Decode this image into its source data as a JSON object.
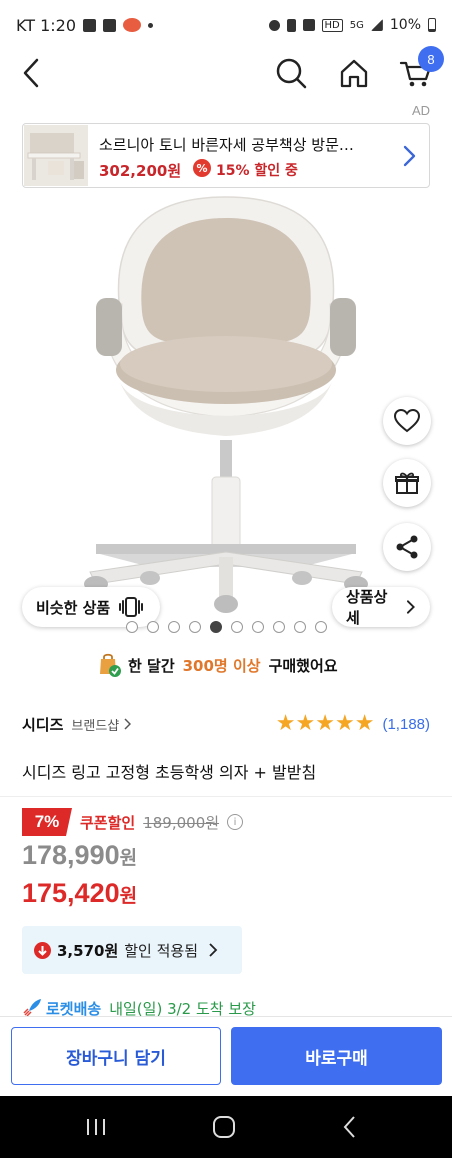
{
  "status_bar": {
    "carrier_time": "KT 1:20",
    "battery": "10%",
    "network": "5G"
  },
  "nav": {
    "cart_count": "8",
    "icons": [
      "back-icon",
      "search-icon",
      "home-icon",
      "cart-icon"
    ]
  },
  "ad": {
    "label": "AD",
    "title": "소르니아 토니 바른자세 공부책상 방문…",
    "price": "302,200원",
    "discount_icon": "%",
    "discount": "15% 할인 중"
  },
  "image": {
    "similar_label": "비슷한 상품",
    "detail_label": "상품상세",
    "dot_count": 10,
    "active_dot": 4
  },
  "purchase": {
    "prefix": "한 달간",
    "count": "300명 이상",
    "suffix": "구매했어요"
  },
  "product": {
    "brand": "시디즈",
    "brand_shop": "브랜드샵",
    "rating_stars": 5,
    "review_count": "(1,188)",
    "title": "시디즈 링고 고정형 초등학생 의자 + 발받침"
  },
  "price": {
    "discount_rate": "7%",
    "coupon_label": "쿠폰할인",
    "original": "189,000원",
    "info_icon": "i",
    "sale_number": "178,990",
    "sale_unit": "원",
    "coupon_number": "175,420",
    "coupon_unit": "원",
    "savings_amount": "3,570원",
    "savings_label": "할인 적용됨"
  },
  "delivery": {
    "rocket_label": "로켓배송",
    "info": "내일(일) 3/2 도착 보장"
  },
  "actions": {
    "cart_label": "장바구니 담기",
    "buy_label": "바로구매"
  },
  "colors": {
    "accent_blue": "#3f6ef0",
    "sale_red": "#dd2a28",
    "rating_star": "#f5a623",
    "purchase_highlight": "#e0772a"
  }
}
